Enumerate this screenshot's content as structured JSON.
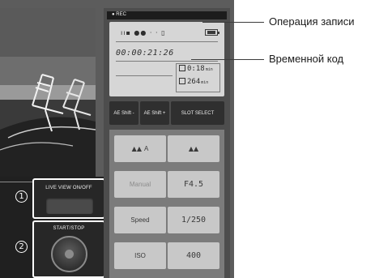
{
  "status_bar": {
    "text": "● REC"
  },
  "lcd": {
    "icons": "ıı▪ ●● · · ▯",
    "timecode": "00:00:21:26",
    "remaining": [
      {
        "value": "0:18",
        "unit": "min"
      },
      {
        "value": "264",
        "unit": "min"
      }
    ]
  },
  "buttons": {
    "ae_shift_minus": "AE Shift -",
    "ae_shift_plus": "AE Shift +",
    "slot_select": "SLOT SELECT"
  },
  "grid": {
    "wb_auto_icon": "▲▲",
    "wb_auto_label": "A",
    "wb_icon": "▲▲",
    "manual_label": "Manual",
    "aperture_value": "F4.5",
    "speed_label": "Speed",
    "speed_value": "1/250",
    "iso_label": "ISO",
    "iso_value": "400"
  },
  "controls": {
    "live_view_label": "LIVE VIEW ON/OFF",
    "start_stop_label": "START/STOP",
    "marker_1": "1",
    "marker_2": "2"
  },
  "callouts": {
    "recording_operation": "Операция записи",
    "timecode": "Временной код"
  },
  "colors": {
    "panel": "#4d4d4d",
    "lcd": "#d6d6d6",
    "button_dark": "#2f2f2f",
    "cell": "#c8c8c8"
  }
}
